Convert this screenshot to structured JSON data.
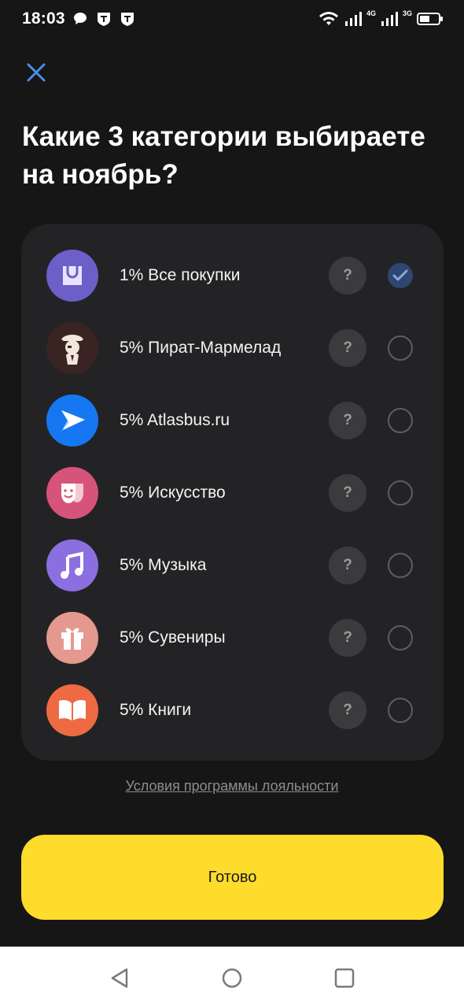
{
  "status_bar": {
    "time": "18:03",
    "network_1": "4G",
    "network_2": "3G"
  },
  "title": "Какие 3 категории выбираете на ноябрь?",
  "categories": [
    {
      "label": "1% Все покупки",
      "icon": "shopping-bag-icon",
      "color": "#6c5fc7",
      "selected": true
    },
    {
      "label": "5% Пират-Мармелад",
      "icon": "pirate-icon",
      "color": "#3a2422",
      "selected": false
    },
    {
      "label": "5% Atlasbus.ru",
      "icon": "atlasbus-play-icon",
      "color": "#1677f2",
      "selected": false
    },
    {
      "label": "5% Искусство",
      "icon": "theater-mask-icon",
      "color": "#d6537a",
      "selected": false
    },
    {
      "label": "5% Музыка",
      "icon": "music-note-icon",
      "color": "#8b6fe0",
      "selected": false
    },
    {
      "label": "5% Сувениры",
      "icon": "gift-icon",
      "color": "#e5988d",
      "selected": false
    },
    {
      "label": "5% Книги",
      "icon": "book-icon",
      "color": "#ee6a43",
      "selected": false
    }
  ],
  "help_label": "?",
  "loyalty_link": "Условия программы лояльности",
  "done_button": "Готово",
  "colors": {
    "background": "#161616",
    "card": "#232325",
    "accent_yellow": "#fddc2b",
    "close_icon": "#4a8ee8"
  }
}
